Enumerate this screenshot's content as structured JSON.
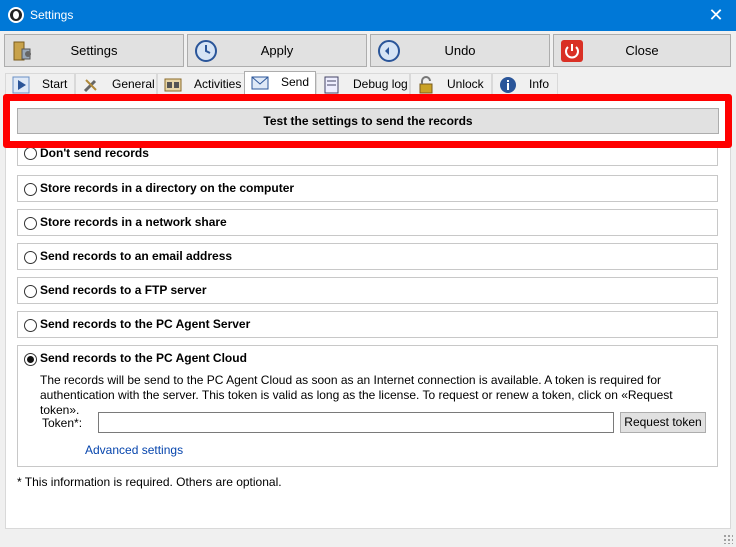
{
  "window": {
    "title": "Settings",
    "close_glyph": "✕"
  },
  "toolbar": {
    "settings_label": "Settings",
    "apply_label": "Apply",
    "undo_label": "Undo",
    "close_label": "Close"
  },
  "tabs": [
    {
      "label": "Start",
      "icon": "play-icon"
    },
    {
      "label": "General",
      "icon": "tools-icon"
    },
    {
      "label": "Activities",
      "icon": "activities-icon"
    },
    {
      "label": "Send",
      "icon": "send-icon",
      "active": true
    },
    {
      "label": "Debug log",
      "icon": "log-icon"
    },
    {
      "label": "Unlock",
      "icon": "lock-icon"
    },
    {
      "label": "Info",
      "icon": "info-icon"
    }
  ],
  "send": {
    "test_button_label": "Test the settings to send the records",
    "options": [
      {
        "label": "Don't send records",
        "selected": false
      },
      {
        "label": "Store records in a directory on the computer",
        "selected": false
      },
      {
        "label": "Store records in a network share",
        "selected": false
      },
      {
        "label": "Send records to an email address",
        "selected": false
      },
      {
        "label": "Send records to a FTP server",
        "selected": false
      },
      {
        "label": "Send records to the PC Agent Server",
        "selected": false
      },
      {
        "label": "Send records to the PC Agent Cloud",
        "selected": true
      }
    ],
    "cloud_description": "The records will be send to the PC Agent Cloud as soon as an Internet connection is available. A token is required for authentication with the server. This token is valid as long as the license. To request or renew a token, click on «Request token».",
    "token_label": "Token*:",
    "token_value": "",
    "request_token_label": "Request token",
    "advanced_settings_label": "Advanced settings",
    "footnote": "* This information is required. Others are optional."
  },
  "colors": {
    "titlebar": "#0078d7",
    "highlight": "#ff0000",
    "link": "#0645ad"
  }
}
